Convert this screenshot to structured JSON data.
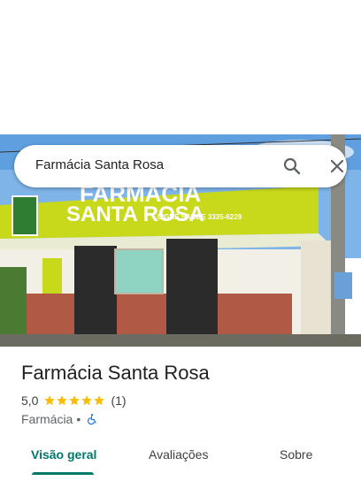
{
  "search": {
    "query": "Farmácia Santa Rosa"
  },
  "photo": {
    "sign_line1": "FARMÁCIA",
    "sign_line2": "SANTA ROSA",
    "sign_phone": "LIGUE SAÚDE 3335-6229"
  },
  "place": {
    "title": "Farmácia Santa Rosa",
    "rating": "5,0",
    "stars": 5,
    "review_count": "(1)",
    "category": "Farmácia",
    "separator": "•"
  },
  "tabs": [
    {
      "label": "Visão geral",
      "active": true
    },
    {
      "label": "Avaliações",
      "active": false
    },
    {
      "label": "Sobre",
      "active": false
    }
  ],
  "colors": {
    "accent": "#00796b",
    "star": "#fbbc04",
    "accessibility_icon": "#1a73e8"
  },
  "icons": {
    "search": "search-icon",
    "close": "close-icon",
    "accessibility": "wheelchair-icon"
  }
}
